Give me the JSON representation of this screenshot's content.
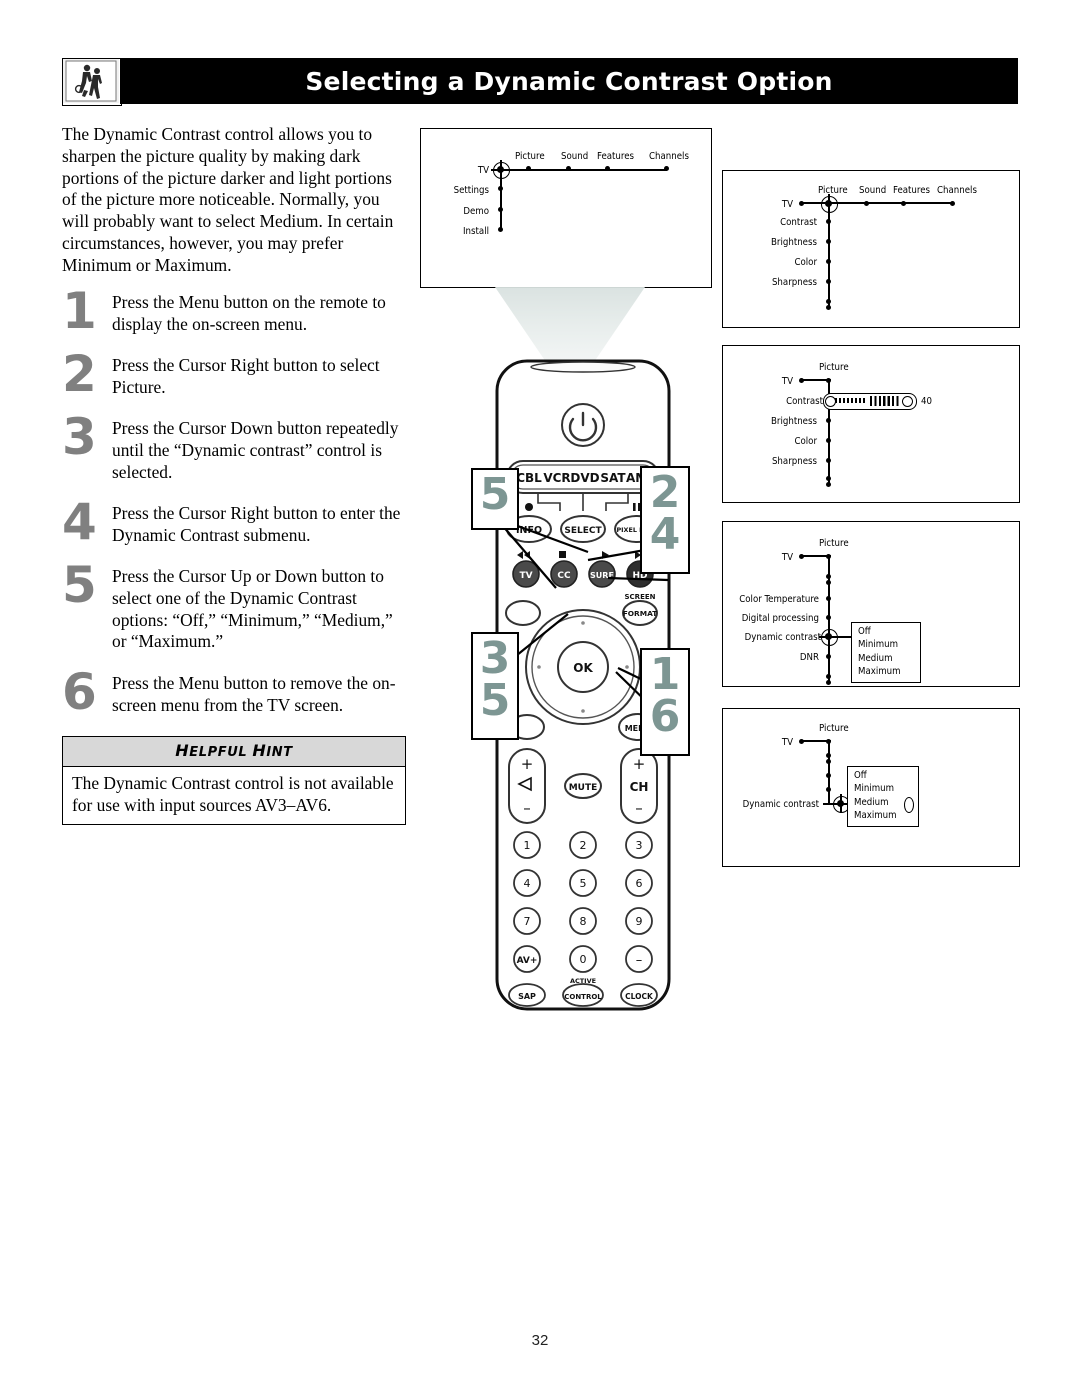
{
  "header": {
    "title": "Selecting a Dynamic Contrast Option",
    "logo_icon": "two-figures-photo-icon"
  },
  "intro": {
    "paragraph": "The Dynamic Contrast control allows you to sharpen the picture quality by making dark portions of the picture darker and light portions of the picture more noticeable. Normally, you will probably want to select Medium. In certain circumstances, however, you may prefer Minimum or Maximum."
  },
  "steps": [
    {
      "num": "1",
      "text": "Press the Menu button on the remote to display the on-screen menu."
    },
    {
      "num": "2",
      "text": "Press the Cursor Right button to select Picture."
    },
    {
      "num": "3",
      "text": "Press the Cursor Down button repeatedly until the “Dynamic contrast” control is selected."
    },
    {
      "num": "4",
      "text": "Press the Cursor Right button to enter the Dynamic Contrast submenu."
    },
    {
      "num": "5",
      "text": "Press the Cursor Up or Down button to select one of the Dynamic Contrast options: “Off,” “Minimum,” “Medium,” or “Maximum.”"
    },
    {
      "num": "6",
      "text": "Press the Menu button to remove the on-screen menu from the TV screen."
    }
  ],
  "hint": {
    "title_first": "H",
    "title_rest1": "ELPFUL ",
    "title_h2": "H",
    "title_rest2": "INT",
    "title_full": "HELPFUL HINT",
    "body": "The Dynamic Contrast control is not available for use with input sources AV3–AV6."
  },
  "screens": {
    "screen1": {
      "root_label": "TV",
      "top_items": [
        "Picture",
        "Sound",
        "Features",
        "Channels"
      ],
      "left_items": [
        "Settings",
        "Demo",
        "Install"
      ]
    },
    "screen2": {
      "root_label": "TV",
      "top_items": [
        "Picture",
        "Sound",
        "Features",
        "Channels"
      ],
      "sub_items": [
        "Contrast",
        "Brightness",
        "Color",
        "Sharpness"
      ]
    },
    "screen3": {
      "root_label": "TV",
      "top_item": "Picture",
      "sub_items": [
        "Contrast",
        "Brightness",
        "Color",
        "Sharpness"
      ],
      "slider_label": "Contrast",
      "slider_value": "40"
    },
    "screen4": {
      "root_label": "TV",
      "top_item": "Picture",
      "sub_items": [
        "Color Temperature",
        "Digital processing",
        "Dynamic contrast",
        "DNR"
      ],
      "options": [
        "Off",
        "Minimum",
        "Medium",
        "Maximum"
      ]
    },
    "screen5": {
      "root_label": "TV",
      "top_item": "Picture",
      "selected_label": "Dynamic contrast",
      "options": [
        "Off",
        "Minimum",
        "Medium",
        "Maximum"
      ],
      "highlighted_option": "Medium"
    }
  },
  "remote": {
    "power_icon": "power-icon",
    "device_row": [
      "CBL",
      "VCR",
      "DVD",
      "SAT",
      "AMP"
    ],
    "row_info": [
      "INFO",
      "SELECT",
      "PIXEL PLUS"
    ],
    "row_info_icons": [
      "record-dot-icon",
      "pause-icon"
    ],
    "row_source": [
      "TV",
      "CC",
      "SURF",
      "HD"
    ],
    "row_source_icons": [
      "rewind-icon",
      "stop-icon",
      "play-icon",
      "fast-forward-icon"
    ],
    "screen_format_top": "SCREEN",
    "screen_format": "FORMAT",
    "ok_button": "OK",
    "menu_button": "MENU",
    "volume_plus": "+",
    "volume_minus": "–",
    "volume_icon": "volume-icon",
    "mute_button": "MUTE",
    "channel_label": "CH",
    "channel_plus": "+",
    "channel_minus": "–",
    "keypad": [
      "1",
      "2",
      "3",
      "4",
      "5",
      "6",
      "7",
      "8",
      "9",
      "AV+",
      "0",
      "–"
    ],
    "bottom_row": [
      "SAP",
      "CONTROL",
      "CLOCK"
    ],
    "bottom_row_top_label": "ACTIVE"
  },
  "callouts": {
    "left_top": [
      "5"
    ],
    "left_bottom": [
      "3",
      "5"
    ],
    "right_top": [
      "2",
      "4"
    ],
    "right_bottom": [
      "1",
      "6"
    ],
    "color": "#7d9693"
  },
  "footer": {
    "page_number": "32"
  }
}
